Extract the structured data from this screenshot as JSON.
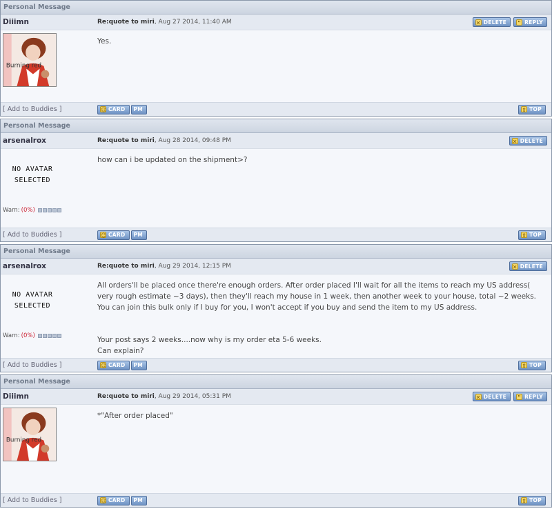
{
  "messages": [
    {
      "title": "Personal Message",
      "author": "Diiimn",
      "subject_prefix": "Re:quote to miri",
      "date": ", Aug 27 2014, 11:40 AM",
      "avatar_caption": "Burning red",
      "paragraphs": [
        "Yes."
      ],
      "buttons": {
        "delete": "DELETE",
        "reply": "REPLY"
      }
    },
    {
      "title": "Personal Message",
      "author": "arsenalrox",
      "subject_prefix": "Re:quote to miri",
      "date": ", Aug 28 2014, 09:48 PM",
      "no_avatar_line1": "NO AVATAR",
      "no_avatar_line2": "SELECTED",
      "warn_label": "Warn:",
      "warn_value": "(0%)",
      "paragraphs": [
        "how can i be updated on the shipment>?"
      ],
      "buttons": {
        "delete": "DELETE"
      }
    },
    {
      "title": "Personal Message",
      "author": "arsenalrox",
      "subject_prefix": "Re:quote to miri",
      "date": ", Aug 29 2014, 12:15 PM",
      "no_avatar_line1": "NO AVATAR",
      "no_avatar_line2": "SELECTED",
      "warn_label": "Warn:",
      "warn_value": "(0%)",
      "paragraphs": [
        "All orders'll be placed once there're enough orders. After order placed I'll wait for all the items to reach my US address( very rough estimate ~3 days), then they'll reach my house in 1 week, then another week to your house, total ~2 weeks. You can join this bulk only if I buy for you, I won't accept if you buy and send the item to my US address.",
        "Your post says 2 weeks....now why is my order eta 5-6 weeks.",
        "Can explain?"
      ],
      "buttons": {
        "delete": "DELETE"
      }
    },
    {
      "title": "Personal Message",
      "author": "Diiimn",
      "subject_prefix": "Re:quote to miri",
      "date": ", Aug 29 2014, 05:31 PM",
      "avatar_caption": "Burning red",
      "paragraphs": [
        "*\"After order placed\""
      ],
      "buttons": {
        "delete": "DELETE",
        "reply": "REPLY"
      }
    }
  ],
  "footer": {
    "add_buddies": "[ Add to Buddies ]",
    "card": "CARD",
    "pm": "PM",
    "top": "TOP"
  },
  "icons": {
    "delete": "x-icon",
    "reply": "quote-icon",
    "card": "user-icon",
    "top": "arrow-up-icon"
  },
  "colors": {
    "button_bg": "#7d9ccb",
    "header_bg": "#cdd5e1",
    "body_bg": "#f5f7fb",
    "warn_pct": "#cc2233"
  }
}
